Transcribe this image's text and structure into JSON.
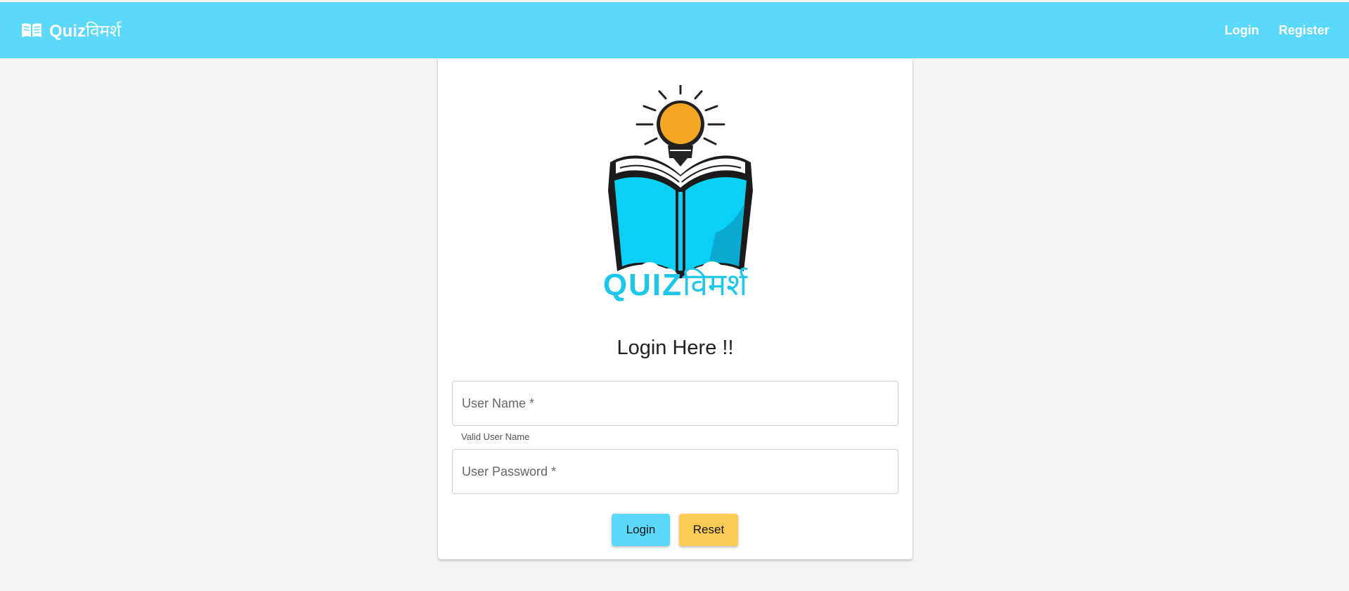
{
  "header": {
    "brand_latin": "Quiz",
    "brand_devanagari": "विमर्श",
    "brand_icon": "open-book-icon",
    "nav": {
      "login": "Login",
      "register": "Register"
    }
  },
  "logo": {
    "word_latin": "QUIZ",
    "word_devanagari": "विमर्श",
    "image": "lightbulb-open-book-logo"
  },
  "form": {
    "title": "Login Here !!",
    "username": {
      "placeholder": "User Name *",
      "value": "",
      "hint": "Valid User Name"
    },
    "password": {
      "placeholder": "User Password *",
      "value": ""
    },
    "buttons": {
      "login": "Login",
      "reset": "Reset"
    }
  },
  "colors": {
    "header_bg": "#5bd9fa",
    "login_button": "#5bd9fa",
    "reset_button": "#fccb54",
    "logo_text": "#1ec6ec",
    "bulb": "#f5a623",
    "book": "#0ad0f5"
  }
}
